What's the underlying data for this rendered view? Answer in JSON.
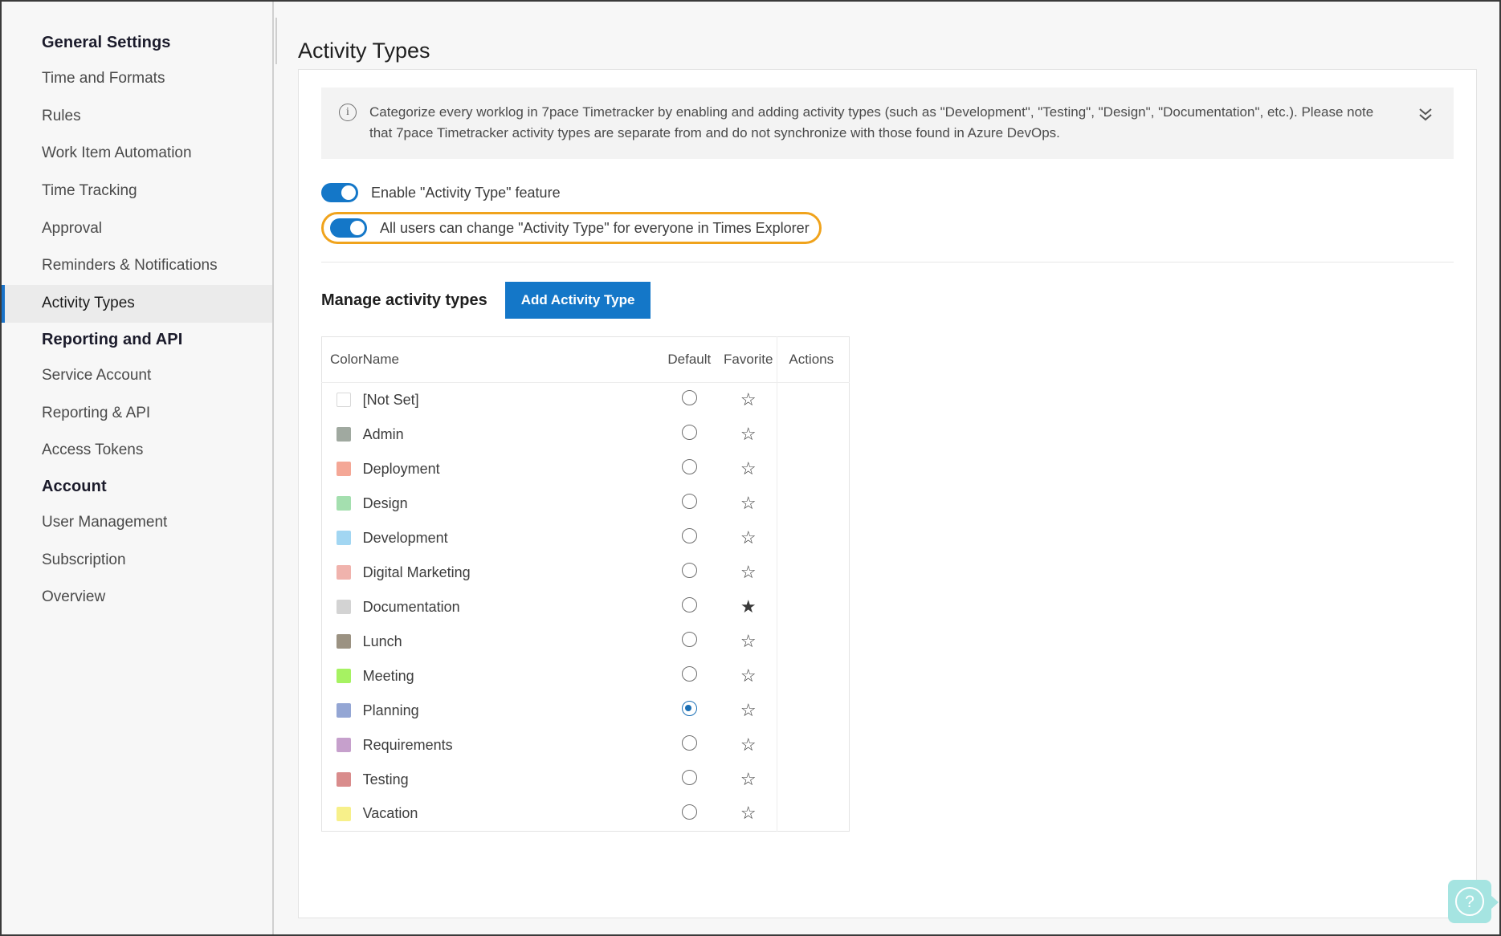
{
  "sidebar": {
    "groups": [
      {
        "title": "General Settings",
        "items": [
          {
            "label": "Time and Formats",
            "active": false
          },
          {
            "label": "Rules",
            "active": false
          },
          {
            "label": "Work Item Automation",
            "active": false
          },
          {
            "label": "Time Tracking",
            "active": false
          },
          {
            "label": "Approval",
            "active": false
          },
          {
            "label": "Reminders & Notifications",
            "active": false
          },
          {
            "label": "Activity Types",
            "active": true
          }
        ]
      },
      {
        "title": "Reporting and API",
        "items": [
          {
            "label": "Service Account",
            "active": false
          },
          {
            "label": "Reporting & API",
            "active": false
          },
          {
            "label": "Access Tokens",
            "active": false
          }
        ]
      },
      {
        "title": "Account",
        "items": [
          {
            "label": "User Management",
            "active": false
          },
          {
            "label": "Subscription",
            "active": false
          },
          {
            "label": "Overview",
            "active": false
          }
        ]
      }
    ]
  },
  "page": {
    "title": "Activity Types"
  },
  "banner": {
    "icon": "info-icon",
    "text": "Categorize every worklog in 7pace Timetracker by enabling and adding activity types (such as \"Development\", \"Testing\", \"Design\", \"Documentation\", etc.). Please note that 7pace Timetracker activity types are separate from and do not synchronize with those found in Azure DevOps.",
    "collapse_icon": "double-chevron-down-icon"
  },
  "toggles": [
    {
      "label": "Enable \"Activity Type\" feature",
      "on": true,
      "highlighted": false
    },
    {
      "label": "All users can change \"Activity Type\" for everyone in Times Explorer",
      "on": true,
      "highlighted": true
    }
  ],
  "manage": {
    "title": "Manage activity types",
    "add_button_label": "Add Activity Type"
  },
  "table": {
    "headers": {
      "color": "Color",
      "name": "Name",
      "default": "Default",
      "favorite": "Favorite",
      "actions": "Actions"
    },
    "rows": [
      {
        "name": "[Not Set]",
        "color": "",
        "default": false,
        "favorite": false
      },
      {
        "name": "Admin",
        "color": "#a0a9a0",
        "default": false,
        "favorite": false
      },
      {
        "name": "Deployment",
        "color": "#f4a796",
        "default": false,
        "favorite": false
      },
      {
        "name": "Design",
        "color": "#a4dfaf",
        "default": false,
        "favorite": false
      },
      {
        "name": "Development",
        "color": "#a2d6f2",
        "default": false,
        "favorite": false
      },
      {
        "name": "Digital Marketing",
        "color": "#f0b3ad",
        "default": false,
        "favorite": false
      },
      {
        "name": "Documentation",
        "color": "#d3d3d3",
        "default": false,
        "favorite": true
      },
      {
        "name": "Lunch",
        "color": "#9b9282",
        "default": false,
        "favorite": false
      },
      {
        "name": "Meeting",
        "color": "#a6f262",
        "default": false,
        "favorite": false
      },
      {
        "name": "Planning",
        "color": "#94a6d4",
        "default": true,
        "favorite": false
      },
      {
        "name": "Requirements",
        "color": "#c6a0cc",
        "default": false,
        "favorite": false
      },
      {
        "name": "Testing",
        "color": "#d98c8c",
        "default": false,
        "favorite": false
      },
      {
        "name": "Vacation",
        "color": "#f7f08a",
        "default": false,
        "favorite": false
      }
    ]
  },
  "help": {
    "icon": "question-mark-icon",
    "label": "?"
  },
  "colors": {
    "accent_blue": "#1477c8",
    "highlight_orange": "#f0a31c",
    "active_nav_bar": "#1a73c8",
    "help_teal": "#a5e4e1"
  },
  "glyphs": {
    "star_empty": "☆",
    "star_filled": "★",
    "info": "i"
  }
}
